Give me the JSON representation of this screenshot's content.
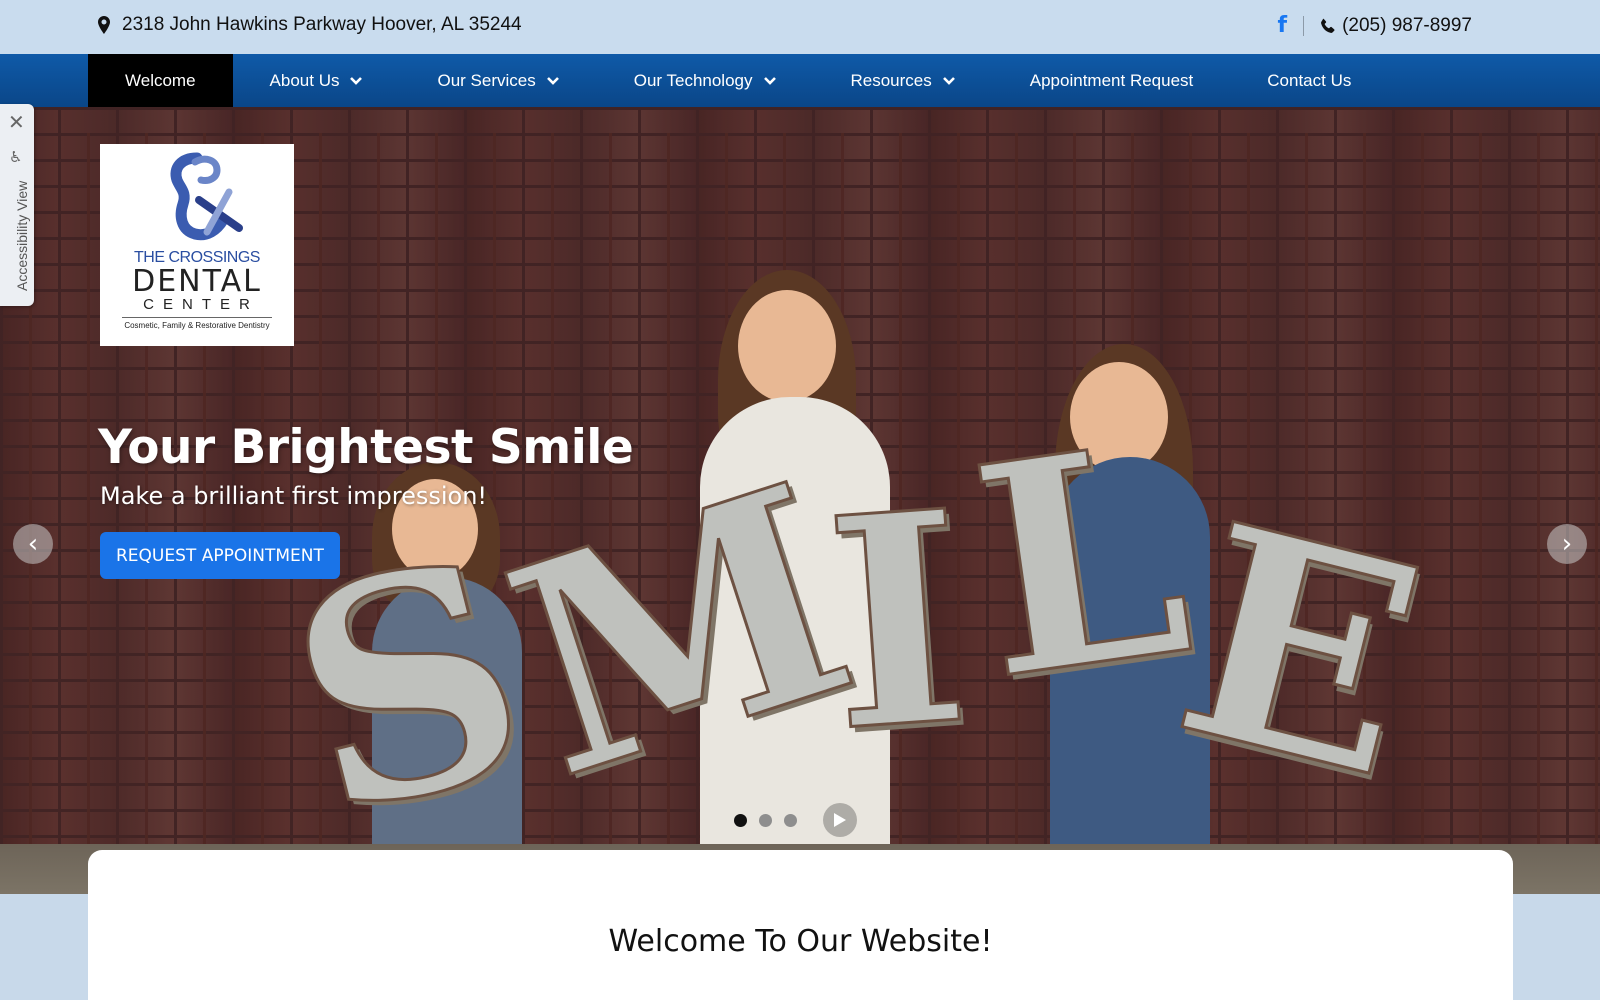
{
  "topbar": {
    "address": "2318 John Hawkins Parkway Hoover, AL 35244",
    "facebook_icon": "f",
    "phone": "(205) 987-8997"
  },
  "nav": {
    "items": [
      {
        "label": "Welcome",
        "active": true,
        "dropdown": false
      },
      {
        "label": "About Us",
        "active": false,
        "dropdown": true
      },
      {
        "label": "Our Services",
        "active": false,
        "dropdown": true
      },
      {
        "label": "Our Technology",
        "active": false,
        "dropdown": true
      },
      {
        "label": "Resources",
        "active": false,
        "dropdown": true
      },
      {
        "label": "Appointment Request",
        "active": false,
        "dropdown": false
      },
      {
        "label": "Contact Us",
        "active": false,
        "dropdown": false
      }
    ]
  },
  "accessibility": {
    "label": "Accessibility View",
    "close": "✕"
  },
  "logo": {
    "line1": "THE CROSSINGS",
    "line2": "DENTAL",
    "line3": "CENTER",
    "tagline": "Cosmetic, Family & Restorative Dentistry"
  },
  "hero": {
    "title": "Your Brightest Smile",
    "subtitle": "Make a brilliant first impression!",
    "button": "REQUEST APPOINTMENT",
    "letters": [
      "S",
      "M",
      "I",
      "L",
      "E"
    ],
    "prev": "‹",
    "next": "›",
    "slides": 3,
    "active_slide": 1
  },
  "welcome": {
    "heading": "Welcome To Our Website!"
  },
  "colors": {
    "nav": "#0f5aa8",
    "topbar": "#c9dcee",
    "button": "#1a74e8",
    "brand_blue": "#2a4ea1"
  }
}
